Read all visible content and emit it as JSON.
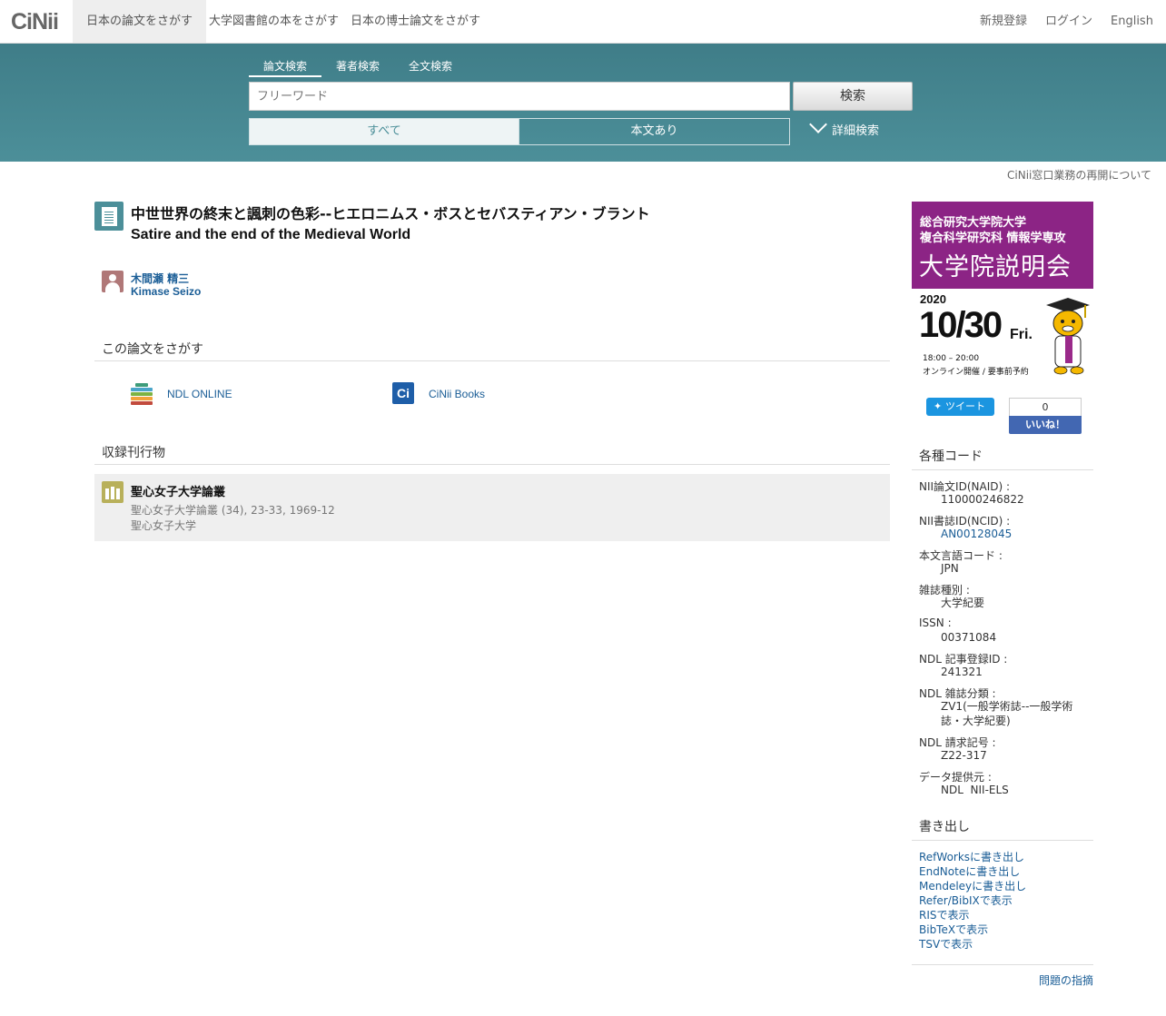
{
  "nav": {
    "logo": "CiNii",
    "items": [
      "日本の論文をさがす",
      "大学図書館の本をさがす",
      "日本の博士論文をさがす"
    ],
    "right": [
      "新規登録",
      "ログイン",
      "English"
    ]
  },
  "search": {
    "tabs": [
      "論文検索",
      "著者検索",
      "全文検索"
    ],
    "placeholder": "フリーワード",
    "button": "検索",
    "toggle_all": "すべて",
    "toggle_fulltext": "本文あり",
    "advanced": "詳細検索"
  },
  "notice": "CiNii窓口業務の再開について",
  "article": {
    "title_ja": "中世世界の終末と諷刺の色彩--ヒエロニムス・ボスとセバスティアン・ブラント",
    "title_en": "Satire and the end of the Medieval World",
    "author_ja": "木間瀬 精三",
    "author_en": "Kimase Seizo"
  },
  "find": {
    "heading": "この論文をさがす",
    "ndl": "NDL ONLINE",
    "cinii_books": "CiNii Books"
  },
  "journal": {
    "heading": "収録刊行物",
    "title": "聖心女子大学論叢",
    "citation": "聖心女子大学論叢 (34), 23-33, 1969-12",
    "publisher": "聖心女子大学"
  },
  "ad": {
    "line1": "総合研究大学院大学",
    "line2": "複合科学研究科 情報学専攻",
    "line3": "大学院説明会",
    "year": "2020",
    "date": "10/30",
    "dow": "Fri.",
    "time": "18:00 – 20:00",
    "note": "オンライン開催 / 要事前予約"
  },
  "social": {
    "tweet": "ツイート",
    "like_count": "0",
    "like": "いいね！"
  },
  "codes": {
    "heading": "各種コード",
    "items": [
      {
        "label": "NII論文ID(NAID) :",
        "value": "110000246822"
      },
      {
        "label": "NII書誌ID(NCID) :",
        "value": "AN00128045"
      },
      {
        "label": "本文言語コード :",
        "value": "JPN"
      },
      {
        "label": "雑誌種別 :",
        "value": "大学紀要"
      },
      {
        "label": "ISSN :",
        "value": "00371084"
      },
      {
        "label": "NDL 記事登録ID :",
        "value": "241321"
      },
      {
        "label": "NDL 雑誌分類 :",
        "value": "ZV1(一般学術誌--一般学術誌・大学紀要)"
      },
      {
        "label": "NDL 請求記号 :",
        "value": "Z22-317"
      },
      {
        "label": "データ提供元 :",
        "value": "NDL  NII-ELS"
      }
    ]
  },
  "export": {
    "heading": "書き出し",
    "links": [
      "RefWorksに書き出し",
      "EndNoteに書き出し",
      "Mendeleyに書き出し",
      "Refer/BibIXで表示",
      "RISで表示",
      "BibTeXで表示",
      "TSVで表示"
    ]
  },
  "report": "問題の指摘"
}
